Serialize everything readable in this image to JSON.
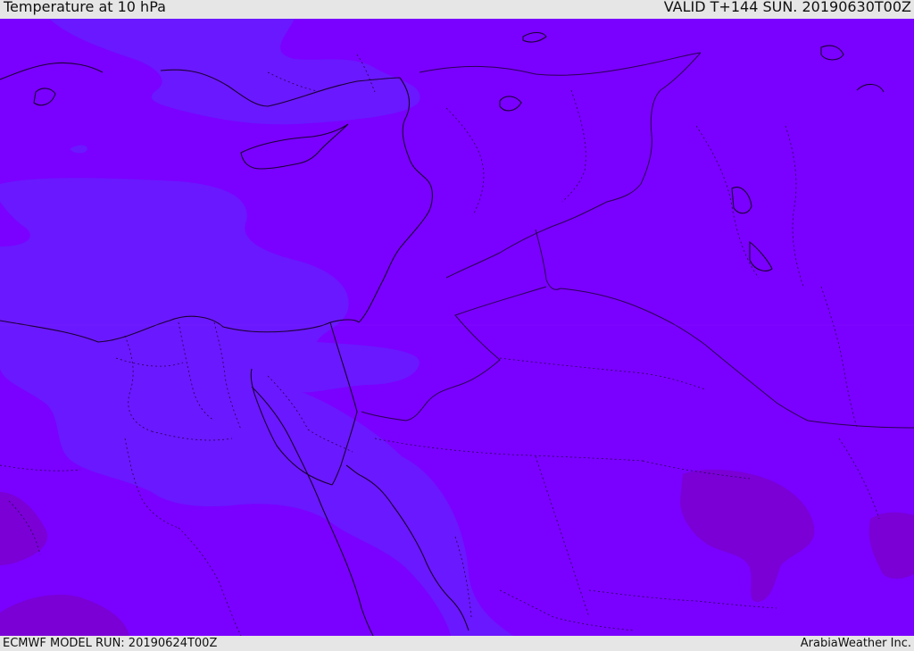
{
  "header": {
    "title": "Temperature at 10 hPa",
    "valid": "VALID T+144 SUN. 20190630T00Z"
  },
  "footer": {
    "model_run": "ECMWF MODEL RUN: 20190624T00Z",
    "credit": "ArabiaWeather Inc."
  },
  "colors": {
    "background_field": "#7a00ff",
    "cooler_field": "#6a18ff",
    "warmer_field": "#7a00d6",
    "coastline": "#1a0030",
    "border": "#2a0050"
  }
}
